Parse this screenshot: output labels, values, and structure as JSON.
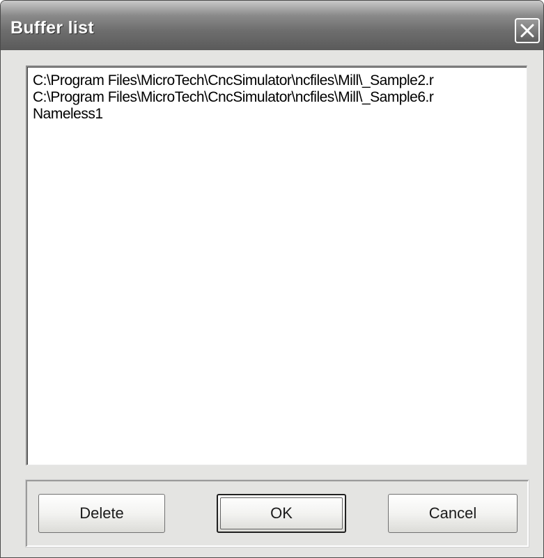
{
  "window": {
    "title": "Buffer list"
  },
  "titlebar": {
    "close_icon": "close-icon"
  },
  "buffer_list": {
    "items": [
      "C:\\Program Files\\MicroTech\\CncSimulator\\ncfiles\\Mill\\_Sample2.r",
      "C:\\Program Files\\MicroTech\\CncSimulator\\ncfiles\\Mill\\_Sample6.r",
      "Nameless1"
    ]
  },
  "buttons": {
    "delete_label": "Delete",
    "ok_label": "OK",
    "cancel_label": "Cancel"
  },
  "colors": {
    "titlebar": "#6e6e6e",
    "dialog_face": "#e4e4e2",
    "list_background": "#ffffff"
  }
}
